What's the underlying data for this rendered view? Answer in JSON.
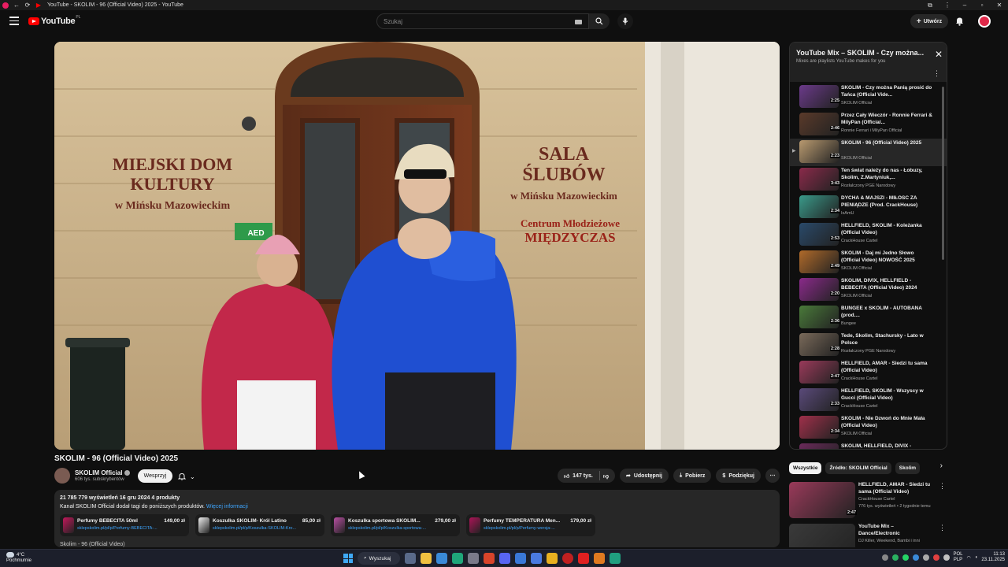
{
  "window": {
    "title": "YouTube - SKOLIM - 96 (Official Video) 2025 - YouTube"
  },
  "masthead": {
    "logo_text": "YouTube",
    "country_code": "PL",
    "search_placeholder": "Szukaj",
    "create_label": "Utwórz"
  },
  "video": {
    "title": "SKOLIM - 96 (Official Video) 2025",
    "channel": "SKOLIM Official",
    "subscribers": "606 tys. subskrybentów",
    "support_label": "Wesprzyj",
    "likes": "147 tys.",
    "share_label": "Udostępnij",
    "download_label": "Pobierz",
    "thanks_label": "Podziękuj",
    "scene_sign_left": [
      "MIEJSKI DOM",
      "KULTURY",
      "w Mińsku Mazowieckim"
    ],
    "scene_sign_right": [
      "SALA",
      "ŚLUBÓW",
      "w Mińsku Mazowieckim"
    ],
    "scene_sign_right2": [
      "Centrum Młodzieżowe",
      "MIĘDZYCZAS"
    ],
    "scene_aed": "AED"
  },
  "description": {
    "meta": "21 785 779 wyświetleń  16 gru 2024  4 produkty",
    "note": "Kanał SKOLIM Official dodał tagi do poniższych produktów.",
    "more": "Więcej informacji",
    "footer": "Skolim - 96  (Official Video)",
    "products": [
      {
        "name": "Perfumy BEBECITA 50ml",
        "price": "149,00 zł",
        "url": "sklepskolim.pl/pl/p/Perfumy-BEBECITA-...",
        "color": "#c2185b"
      },
      {
        "name": "Koszulka SKOLIM- Król Latino",
        "price": "85,00 zł",
        "url": "sklepskolim.pl/pl/p/Koszulka-SKOLIM-Kro...",
        "color": "#eeeeee"
      },
      {
        "name": "Koszulka sportowa SKOLIM...",
        "price": "279,00 zł",
        "url": "sklepskolim.pl/pl/p/Koszulka-sportowa-...",
        "color": "#b94fa3"
      },
      {
        "name": "Perfumy TEMPERATURA Men...",
        "price": "179,00 zł",
        "url": "sklepskolim.pl/pl/p/Perfumy-wersja-...",
        "color": "#ad1457"
      }
    ]
  },
  "playlist": {
    "title": "YouTube Mix – SKOLIM - Czy można...",
    "subtitle": "Mixes are playlists YouTube makes for you",
    "items": [
      {
        "title": "SKOLIM - Czy można Panią prosić do Tańca (Official Vide...",
        "channel": "SKOLIM Official",
        "duration": "2:25",
        "color": "#6b3a8a"
      },
      {
        "title": "Przez Cały Wieczór - Ronnie Ferrari & MilyPan (Official...",
        "channel": "Ronnie Ferrari i MilyPan Official",
        "duration": "2:46",
        "color": "#5a3a2a"
      },
      {
        "title": "SKOLIM - 96 (Official Video) 2025",
        "channel": "SKOLIM Official",
        "duration": "2:23",
        "color": "#b99a70"
      },
      {
        "title": "Ten świat należy do nas - Łobuzy, Skolim, Z.Martyniuk,...",
        "channel": "Rozłalczony PGE Narodowy",
        "duration": "3:43",
        "color": "#8a2a4a"
      },
      {
        "title": "DYCHA & MAJSZI - MIŁOŚĆ ZA PIENIĄDZE (Prod. CrackHouse)",
        "channel": "IsAmU",
        "duration": "2:34",
        "color": "#3a9a8a"
      },
      {
        "title": "HELLFIELD, SKOLIM - Koleżanka (Official Video)",
        "channel": "CrackHouse Cartel",
        "duration": "2:53",
        "color": "#2a4a6a"
      },
      {
        "title": "SKOLIM - Daj mi Jedno Słowo (Official Video) NOWOŚĆ 2025",
        "channel": "SKOLIM Official",
        "duration": "2:49",
        "color": "#b06a2a"
      },
      {
        "title": "SKOLIM, DIVIX, HELLFIELD - BEBECITA (Official Video) 2024",
        "channel": "SKOLIM Official",
        "duration": "2:20",
        "color": "#8a2a8a"
      },
      {
        "title": "BUNGEE x SKOLIM - AUTOBANA (prod....",
        "channel": "Bungee",
        "duration": "2:36",
        "color": "#4a7a3a"
      },
      {
        "title": "Tede, Skolim, Stachursky - Lato w Polsce",
        "channel": "Rozłalczony PGE Narodowy",
        "duration": "2:28",
        "color": "#7a6a5a"
      },
      {
        "title": "HELLFIELD, AMAR - Siedzi tu sama (Official Video)",
        "channel": "CrackHouse Cartel",
        "duration": "2:47",
        "color": "#9a3a5a"
      },
      {
        "title": "HELLFIELD, SKOLIM - Wszyscy w Gucci (Official Video)",
        "channel": "CrackHouse Cartel",
        "duration": "2:33",
        "color": "#5a4a7a"
      },
      {
        "title": "SKOLIM - Nie Dzwoń do Mnie Mała (Official Video)",
        "channel": "SKOLIM Official",
        "duration": "2:34",
        "color": "#a0304a"
      },
      {
        "title": "SKOLIM, HELLFIELD, DIVIX -",
        "channel": "",
        "duration": "",
        "color": "#6a2a5a"
      }
    ]
  },
  "chips": [
    "Wszystkie",
    "Źródło: SKOLIM Official",
    "Skolim"
  ],
  "recommendations": [
    {
      "title": "HELLFIELD, AMAR - Siedzi tu sama (Official Video)",
      "channel": "CrackHouse Cartel",
      "views": "776 tys. wyświetleń • 2 tygodnie temu",
      "duration": "2:47",
      "color": "#9a3a5a"
    },
    {
      "title": "YouTube Mix – Dance/Electronic",
      "channel": "DJ Killer, Weekend, Bambi i inni",
      "views": "",
      "duration": "",
      "color": "#3a3a3a"
    }
  ],
  "taskbar": {
    "temp": "4°C",
    "weather": "Pochmurnie",
    "search_label": "Wyszukaj",
    "lang1": "POL",
    "lang2": "PLP",
    "time": "11:13",
    "date": "23.11.2025"
  }
}
